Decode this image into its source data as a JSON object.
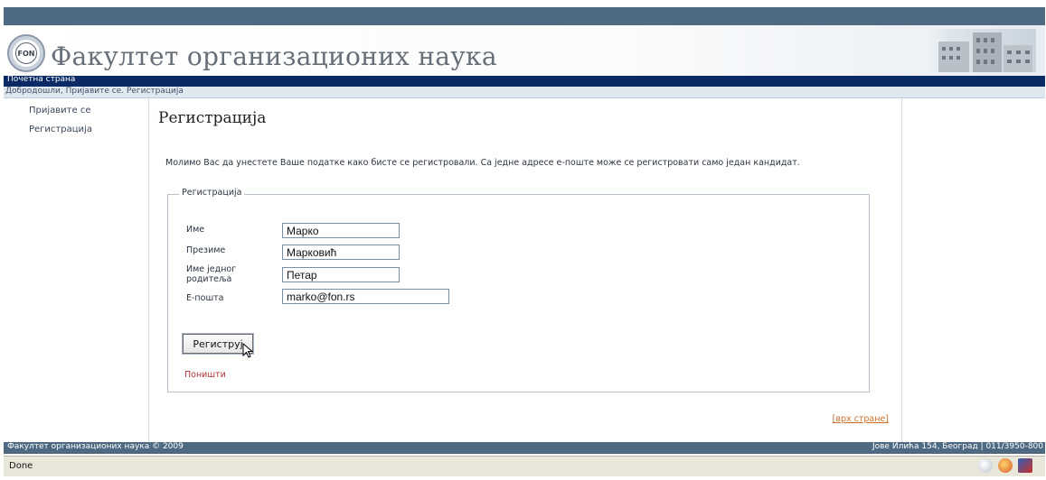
{
  "header": {
    "logo_text": "FON",
    "site_title": "Факултет организационих наука"
  },
  "nav": {
    "home_label": "Почетна страна"
  },
  "breadcrumb": "Добродошли, Пријавите се. Регистрација",
  "sidebar": {
    "items": [
      {
        "label": "Пријавите се"
      },
      {
        "label": "Регистрација"
      }
    ]
  },
  "main": {
    "title": "Регистрација",
    "intro": "Молимо Вас да унестете Ваше податке како бисте се регистровали. Са једне адресе е-поште може се регистровати само један кандидат.",
    "form": {
      "legend": "Регистрација",
      "fields": [
        {
          "label": "Име",
          "value": "Марко"
        },
        {
          "label": "Презиме",
          "value": "Марковић"
        },
        {
          "label": "Име једног родитеља",
          "value": "Петар"
        },
        {
          "label": "Е-пошта",
          "value": "marko@fon.rs"
        }
      ],
      "submit_label": "Региструј",
      "cancel_label": "Поништи"
    },
    "top_link": "[врх стране]"
  },
  "footer": {
    "left": "Факултет организационих наука © 2009",
    "right": "Јове Илића 154, Београд | 011/3950-800"
  },
  "status_bar": {
    "text": "Done"
  },
  "colors": {
    "nav_bg": "#0a2a66",
    "chrome_bg": "#4d6a82",
    "link_red": "#b0343a",
    "link_orange": "#d0702a"
  }
}
